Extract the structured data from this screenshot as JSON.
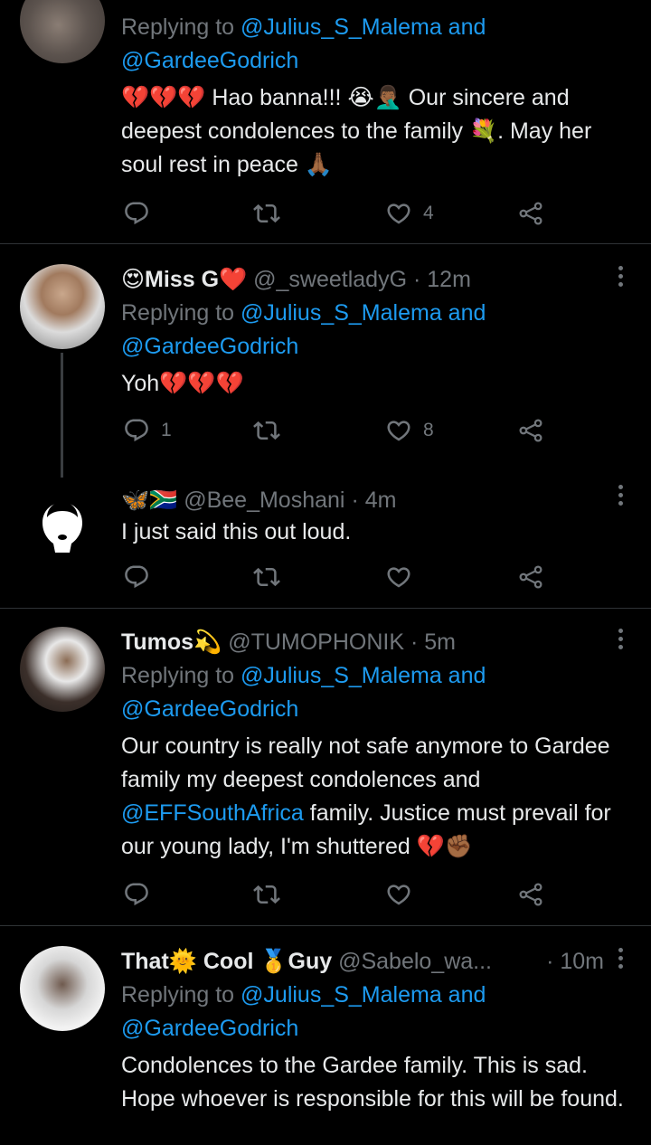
{
  "theme": {
    "bg": "#000000",
    "text": "#e7e9ea",
    "muted": "#71767b",
    "link": "#1d9bf0",
    "heart_emoji": "#e0245e"
  },
  "tweets": [
    {
      "replying_prefix": "Replying to",
      "mention1": "@Julius_S_Malema",
      "and": " and",
      "mention2": "@GardeeGodrich",
      "text_a": "💔💔💔 Hao banna!!! 😭🤦🏾‍♂️ Our sincere and deepest condolences to the family 💐. May her soul rest in peace 🙏🏾",
      "likes": "4"
    },
    {
      "name": "😍Miss G❤️",
      "handle": "@_sweetladyG",
      "time": "· 12m",
      "replying_prefix": "Replying to",
      "mention1": "@Julius_S_Malema",
      "and": " and",
      "mention2": "@GardeeGodrich",
      "text": "Yoh💔💔💔",
      "replies": "1",
      "likes": "8"
    },
    {
      "name": "🦋🇿🇦",
      "handle": "@Bee_Moshani",
      "time": "· 4m",
      "text": "I just said this out loud."
    },
    {
      "name": "Tumos",
      "name_emoji": "💫",
      "handle": "@TUMOPHONIK",
      "time": "· 5m",
      "replying_prefix": "Replying to",
      "mention1": "@Julius_S_Malema",
      "and": " and",
      "mention2": "@GardeeGodrich",
      "text_a": "Our country is really not safe anymore to Gardee family my deepest condolences and ",
      "text_mention": "@EFFSouthAfrica",
      "text_b": " family. Justice must prevail for our young lady, I'm shuttered 💔✊🏾"
    },
    {
      "name_a": "That",
      "name_e1": "🌞",
      "name_b": " Cool ",
      "name_e2": "🥇",
      "name_c": "Guy",
      "handle": "@Sabelo_wa...",
      "time": "· 10m",
      "replying_prefix": "Replying to",
      "mention1": "@Julius_S_Malema",
      "and": " and",
      "mention2": "@GardeeGodrich",
      "text": "Condolences to the Gardee family. This is sad. Hope whoever is responsible for this will be found."
    }
  ]
}
